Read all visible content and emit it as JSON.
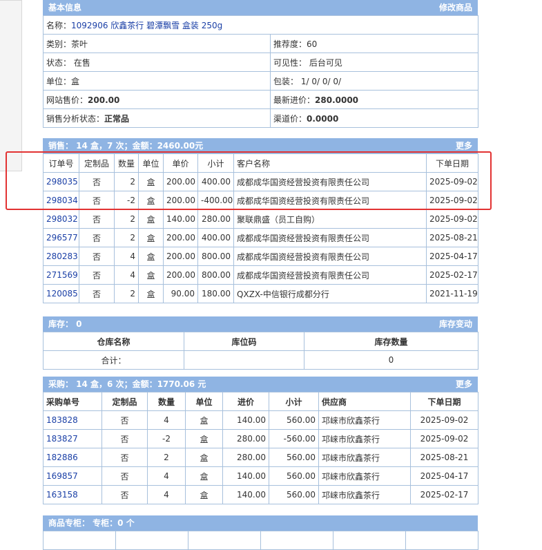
{
  "basic": {
    "title": "基本信息",
    "edit_link": "修改商品",
    "name_label": "名称：",
    "name_value": "1092906 欣鑫茶行 碧潭飘雪 盒装 250g",
    "category_label": "类别：",
    "category_value": "茶叶",
    "recommend_label": "推荐度：",
    "recommend_value": "60",
    "status_label": "状态：",
    "status_value": "在售",
    "visibility_label": "可见性：",
    "visibility_value": "后台可见",
    "unit_label": "单位：",
    "unit_value": "盒",
    "package_label": "包装：",
    "package_value": "1/ 0/ 0/ 0/",
    "web_price_label": "网站售价：",
    "web_price_value": "200.00",
    "latest_cost_label": "最新进价：",
    "latest_cost_value": "280.0000",
    "sales_status_label": "销售分析状态：",
    "sales_status_value": "正常品",
    "channel_price_label": "渠道价：",
    "channel_price_value": "0.0000"
  },
  "sales": {
    "title": "销售： 14 盒，7 次；金额：2460.00元",
    "more": "更多",
    "headers": [
      "订单号",
      "定制品",
      "数量",
      "单位",
      "单价",
      "小计",
      "客户名称",
      "下单日期"
    ],
    "rows": [
      {
        "order": "298035",
        "custom": "否",
        "qty": "2",
        "unit": "盒",
        "price": "200.00",
        "subtotal": "400.00",
        "customer": "成都成华国资经营投资有限责任公司",
        "date": "2025-09-02"
      },
      {
        "order": "298034",
        "custom": "否",
        "qty": "-2",
        "unit": "盒",
        "price": "200.00",
        "subtotal": "-400.00",
        "customer": "成都成华国资经营投资有限责任公司",
        "date": "2025-09-02"
      },
      {
        "order": "298032",
        "custom": "否",
        "qty": "2",
        "unit": "盒",
        "price": "140.00",
        "subtotal": "280.00",
        "customer": "聚联鼎盛（员工自购）",
        "date": "2025-09-02"
      },
      {
        "order": "296577",
        "custom": "否",
        "qty": "2",
        "unit": "盒",
        "price": "200.00",
        "subtotal": "400.00",
        "customer": "成都成华国资经营投资有限责任公司",
        "date": "2025-08-21"
      },
      {
        "order": "280283",
        "custom": "否",
        "qty": "4",
        "unit": "盒",
        "price": "200.00",
        "subtotal": "800.00",
        "customer": "成都成华国资经营投资有限责任公司",
        "date": "2025-04-17"
      },
      {
        "order": "271569",
        "custom": "否",
        "qty": "4",
        "unit": "盒",
        "price": "200.00",
        "subtotal": "800.00",
        "customer": "成都成华国资经营投资有限责任公司",
        "date": "2025-02-17"
      },
      {
        "order": "120085",
        "custom": "否",
        "qty": "2",
        "unit": "盒",
        "price": "90.00",
        "subtotal": "180.00",
        "customer": "QXZX-中信银行成都分行",
        "date": "2021-11-19"
      }
    ]
  },
  "stock": {
    "title": "库存： 0",
    "change_link": "库存变动",
    "headers": [
      "仓库名称",
      "库位码",
      "库存数量"
    ],
    "total_label": "合计：",
    "total_qty": "0"
  },
  "purchase": {
    "title": "采购： 14 盒，6 次；金额：1770.06 元",
    "more": "更多",
    "headers": [
      "采购单号",
      "定制品",
      "数量",
      "单位",
      "进价",
      "小计",
      "供应商",
      "下单日期"
    ],
    "rows": [
      {
        "order": "183828",
        "custom": "否",
        "qty": "4",
        "unit": "盒",
        "price": "140.00",
        "subtotal": "560.00",
        "supplier": "邛崃市欣鑫茶行",
        "date": "2025-09-02"
      },
      {
        "order": "183827",
        "custom": "否",
        "qty": "-2",
        "unit": "盒",
        "price": "280.00",
        "subtotal": "-560.00",
        "supplier": "邛崃市欣鑫茶行",
        "date": "2025-09-02"
      },
      {
        "order": "182886",
        "custom": "否",
        "qty": "2",
        "unit": "盒",
        "price": "280.00",
        "subtotal": "560.00",
        "supplier": "邛崃市欣鑫茶行",
        "date": "2025-08-21"
      },
      {
        "order": "169857",
        "custom": "否",
        "qty": "4",
        "unit": "盒",
        "price": "140.00",
        "subtotal": "560.00",
        "supplier": "邛崃市欣鑫茶行",
        "date": "2025-04-17"
      },
      {
        "order": "163158",
        "custom": "否",
        "qty": "4",
        "unit": "盒",
        "price": "140.00",
        "subtotal": "560.00",
        "supplier": "邛崃市欣鑫茶行",
        "date": "2025-02-17"
      }
    ]
  },
  "counter": {
    "title": "商品专柜： 专柜：0 个"
  }
}
